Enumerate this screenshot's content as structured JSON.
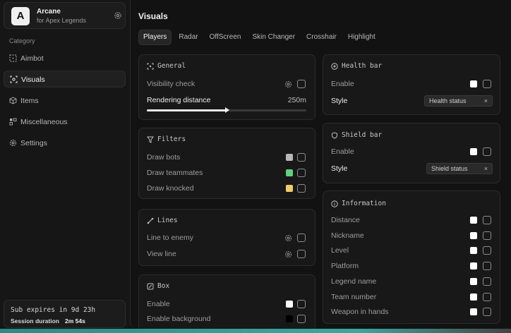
{
  "brand": {
    "name": "Arcane",
    "subtitle": "for Apex Legends",
    "logo_letter": "A"
  },
  "sidebar": {
    "category_label": "Category",
    "items": [
      {
        "label": "Aimbot",
        "icon": "crosshair-dashed-icon",
        "active": false
      },
      {
        "label": "Visuals",
        "icon": "scan-eye-icon",
        "active": true
      },
      {
        "label": "Items",
        "icon": "cube-icon",
        "active": false
      },
      {
        "label": "Miscellaneous",
        "icon": "grid-blocks-icon",
        "active": false
      },
      {
        "label": "Settings",
        "icon": "gear-icon",
        "active": false
      }
    ],
    "subscription": {
      "expires": "Sub expires in 9d 23h",
      "session_label": "Session duration",
      "session_value": "2m 54s"
    }
  },
  "main": {
    "title": "Visuals",
    "tabs": [
      {
        "label": "Players",
        "active": true
      },
      {
        "label": "Radar",
        "active": false
      },
      {
        "label": "OffScreen",
        "active": false
      },
      {
        "label": "Skin Changer",
        "active": false
      },
      {
        "label": "Crosshair",
        "active": false
      },
      {
        "label": "Highlight",
        "active": false
      }
    ]
  },
  "general": {
    "title": "General",
    "visibility_check": "Visibility check",
    "rendering_distance": "Rendering distance",
    "rendering_value": "250m",
    "rendering_fraction": 0.5
  },
  "filters": {
    "title": "Filters",
    "rows": [
      {
        "label": "Draw bots",
        "color": "#b8b8b8"
      },
      {
        "label": "Draw teammates",
        "color": "#5fd27a"
      },
      {
        "label": "Draw knocked",
        "color": "#f0cd6a"
      }
    ]
  },
  "lines": {
    "title": "Lines",
    "rows": [
      {
        "label": "Line to enemy"
      },
      {
        "label": "View line"
      }
    ]
  },
  "box": {
    "title": "Box",
    "rows": [
      {
        "label": "Enable",
        "color": "#ffffff"
      },
      {
        "label": "Enable background",
        "color": "#000000"
      }
    ]
  },
  "health_bar": {
    "title": "Health bar",
    "enable": "Enable",
    "style_label": "Style",
    "style_value": "Health status",
    "close": "×"
  },
  "shield_bar": {
    "title": "Shield bar",
    "enable": "Enable",
    "style_label": "Style",
    "style_value": "Shield status",
    "close": "×"
  },
  "information": {
    "title": "Information",
    "rows": [
      {
        "label": "Distance"
      },
      {
        "label": "Nickname"
      },
      {
        "label": "Level"
      },
      {
        "label": "Platform"
      },
      {
        "label": "Legend name"
      },
      {
        "label": "Team number"
      },
      {
        "label": "Weapon in hands"
      }
    ]
  },
  "colors": {
    "accent_strip": "#3aa8a0"
  }
}
